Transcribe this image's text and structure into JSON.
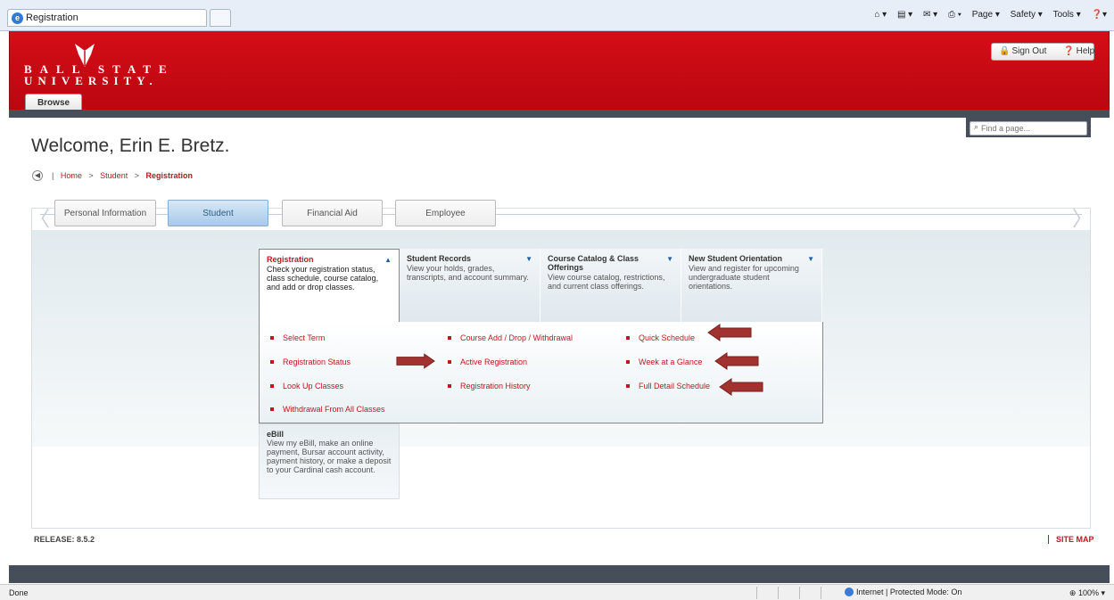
{
  "browser": {
    "tab_title": "Registration",
    "commands": [
      "Page ▾",
      "Safety ▾",
      "Tools ▾"
    ],
    "status_left": "Done",
    "status_zone": "Internet | Protected Mode: On",
    "zoom": "100%"
  },
  "header": {
    "logo_line1": "BALL STATE",
    "logo_line2": "UNIVERSITY.",
    "browse_label": "Browse",
    "sign_out": "Sign Out",
    "help": "Help",
    "find_placeholder": "Find a page..."
  },
  "page": {
    "welcome": "Welcome, Erin E. Bretz.",
    "breadcrumb": {
      "home": "Home",
      "student": "Student",
      "current": "Registration",
      "sep": ">"
    }
  },
  "tabs": [
    "Personal Information",
    "Student",
    "Financial Aid",
    "Employee"
  ],
  "active_tab": "Student",
  "menu": [
    {
      "title": "Registration",
      "desc": "Check your registration status, class schedule, course catalog, and add or drop classes.",
      "caret": "▲"
    },
    {
      "title": "Student Records",
      "desc": "View your holds, grades, transcripts, and account summary.",
      "caret": "▼"
    },
    {
      "title": "Course Catalog & Class Offerings",
      "desc": "View course catalog, restrictions, and current class offerings.",
      "caret": "▼"
    },
    {
      "title": "New Student Orientation",
      "desc": "View and register for upcoming undergraduate student orientations.",
      "caret": "▼"
    }
  ],
  "links": {
    "col1": [
      "Select Term",
      "Registration Status",
      "Look Up Classes",
      "Withdrawal From All Classes"
    ],
    "col2": [
      "Course Add / Drop / Withdrawal",
      "Active Registration",
      "Registration History"
    ],
    "col3": [
      "Quick Schedule",
      "Week at a Glance",
      "Full Detail Schedule"
    ]
  },
  "ebill": {
    "title": "eBill",
    "desc": "View my eBill, make an online payment, Bursar account activity, payment history, or make a deposit to your Cardinal cash account."
  },
  "footer": {
    "release": "RELEASE: 8.5.2",
    "sitemap": "SITE MAP"
  },
  "colors": {
    "brand_red": "#c8101a",
    "link_red": "#c0171e",
    "annotation_arrow": "#a0322f",
    "dark_bar": "#454e59"
  }
}
